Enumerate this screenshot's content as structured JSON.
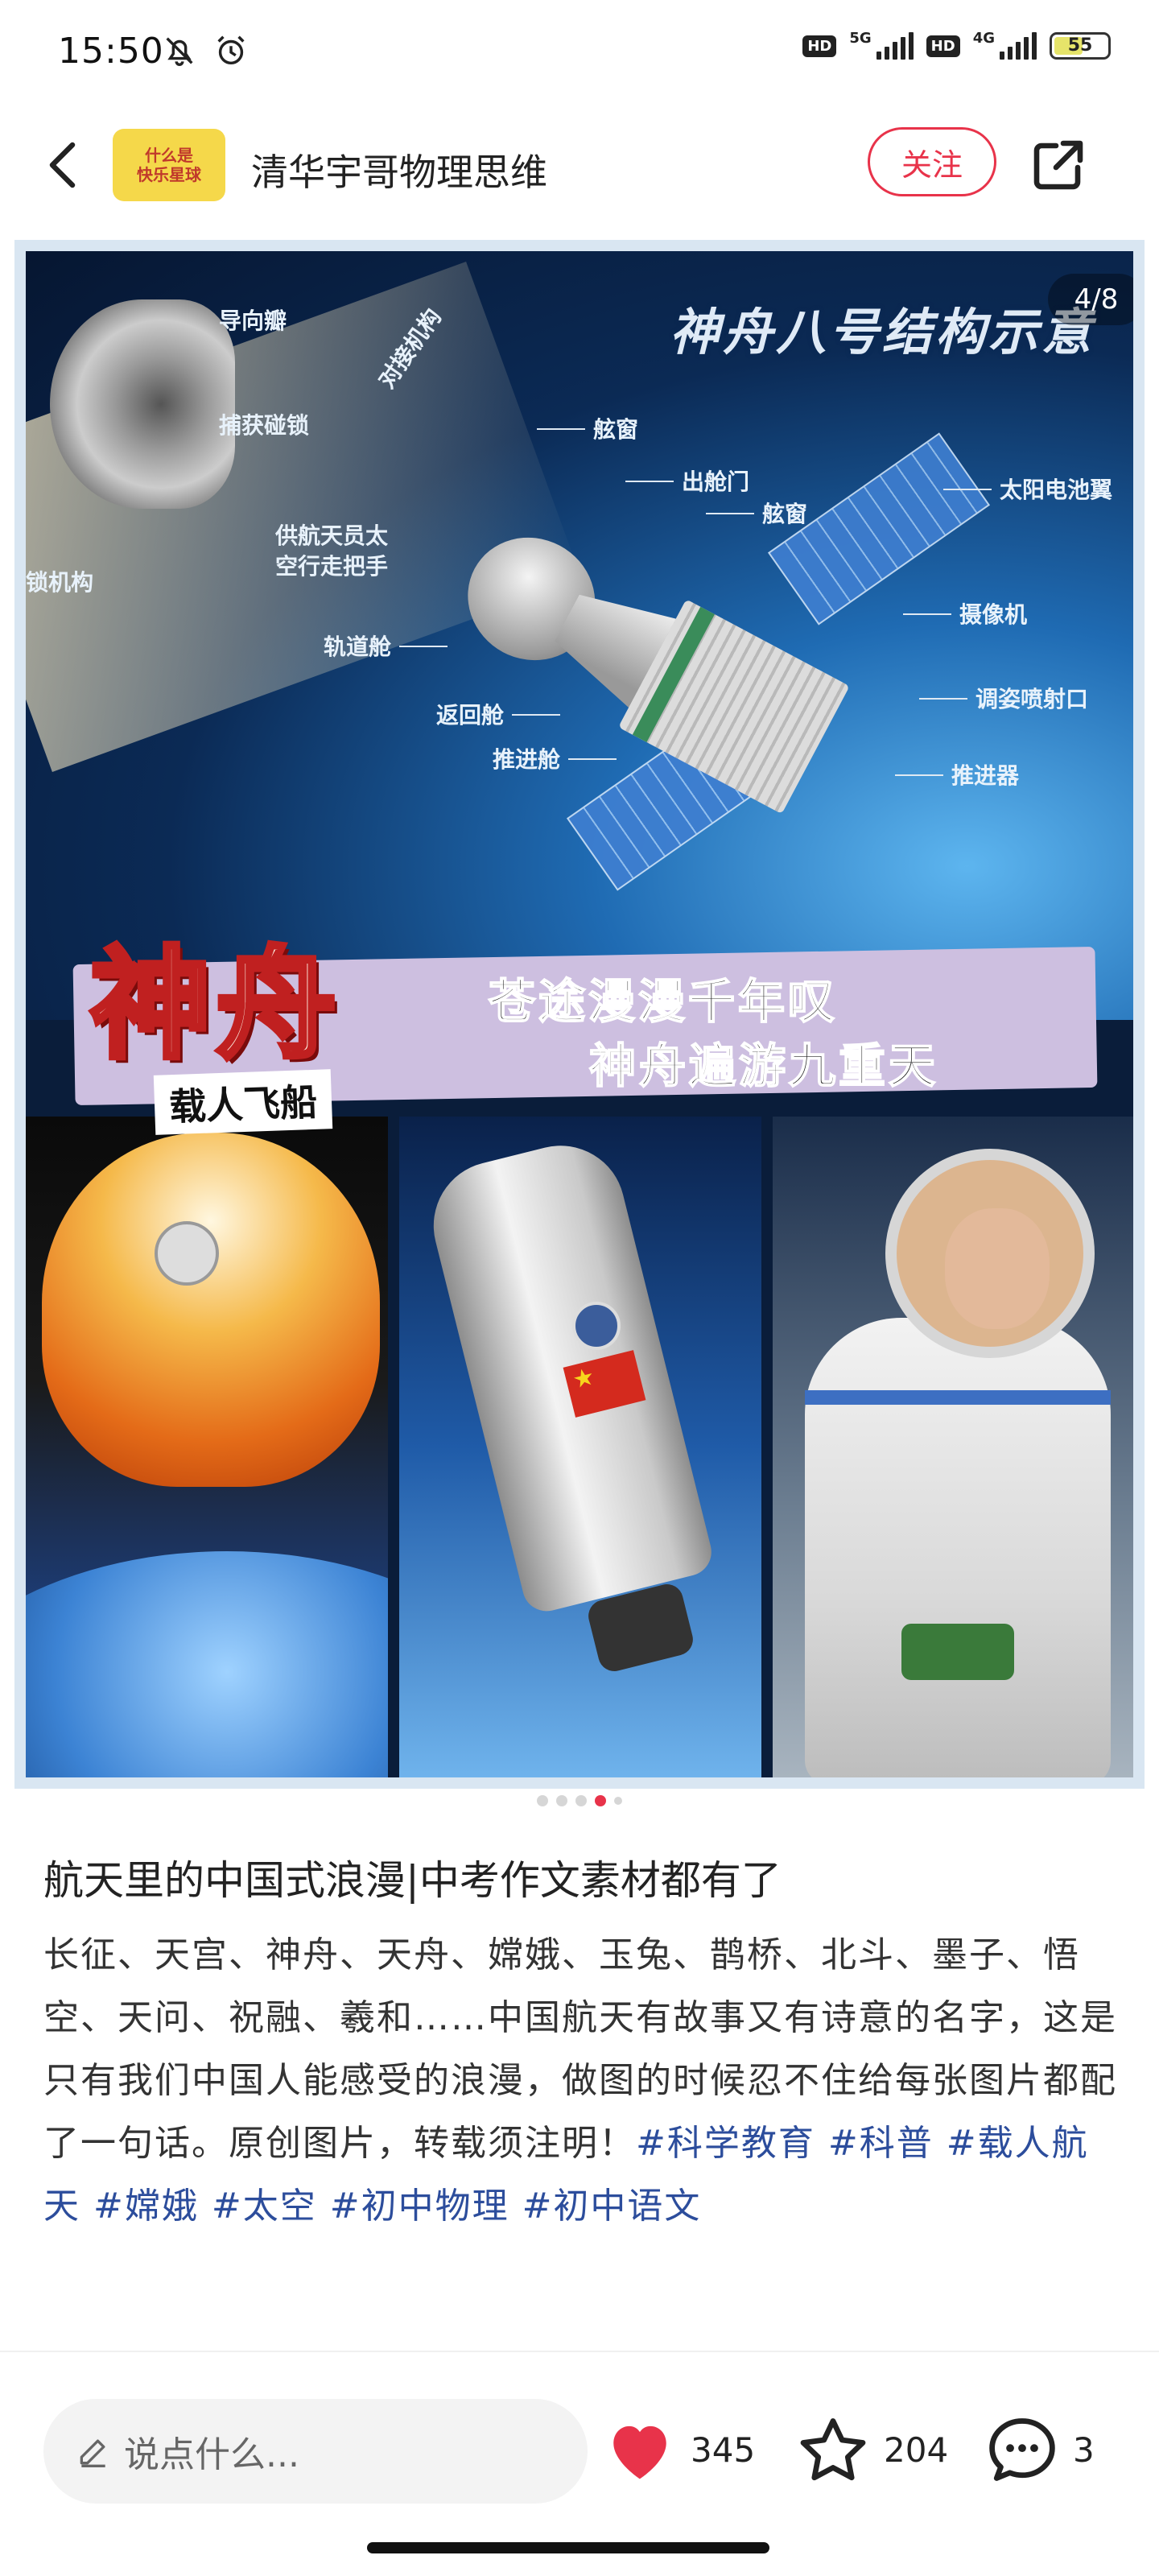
{
  "status_bar": {
    "time": "15:50",
    "network_1": "5G",
    "network_2": "4G",
    "hd_label": "HD",
    "battery": "55",
    "battery_level": 0.55,
    "icons": [
      "mute-bell-icon",
      "alarm-icon",
      "hd-icon",
      "signal-icon",
      "battery-icon"
    ]
  },
  "header": {
    "back_icon": "chevron-left-icon",
    "avatar_text_1": "什么是",
    "avatar_text_2": "快乐星球",
    "author": "清华宇哥物理思维",
    "follow_label": "关注",
    "share_icon": "share-external-icon",
    "follow_color": "#e8334a"
  },
  "image": {
    "page_counter": "4/8",
    "diagram_title": "神舟八号结构示意",
    "labels": {
      "guide": "导向瓣",
      "capture_lock": "捕获碰锁",
      "lock_mechanism": "锁机构",
      "docking": "对接机构",
      "window_1": "舷窗",
      "hatch": "出舱门",
      "window_2": "舷窗",
      "handrail": "供航天员太\n空行走把手",
      "orbital_module": "轨道舱",
      "return_module": "返回舱",
      "propulsion_module": "推进舱",
      "solar_wing": "太阳电池翼",
      "camera": "摄像机",
      "attitude_nozzle": "调姿喷射口",
      "thruster": "推进器"
    },
    "banner_big": "神舟",
    "banner_sub": "载人飞船",
    "poem_line_1": "苍途漫漫千年叹",
    "poem_line_2": "神舟遍游九重天"
  },
  "carousel": {
    "total_dots": 5,
    "active_index": 3
  },
  "post": {
    "title": "航天里的中国式浪漫|中考作文素材都有了",
    "body": "长征、天宫、神舟、天舟、嫦娥、玉兔、鹊桥、北斗、墨子、悟空、天问、祝融、羲和……中国航天有故事又有诗意的名字，这是只有我们中国人能感受的浪漫，做图的时候忍不住给每张图片都配了一句话。原创图片，转载须注明！",
    "tags": [
      "#科学教育",
      "#科普",
      "#载人航天",
      "#嫦娥",
      "#太空",
      "#初中物理",
      "#初中语文"
    ],
    "tag_color": "#2c4d9c"
  },
  "bottom_bar": {
    "comment_placeholder": "说点什么...",
    "comment_icon": "pencil-icon",
    "like_icon": "heart-filled-icon",
    "like_count": "345",
    "like_color": "#e8334a",
    "star_icon": "star-outline-icon",
    "star_count": "204",
    "chat_icon": "chat-bubble-icon",
    "comment_count": "3"
  }
}
